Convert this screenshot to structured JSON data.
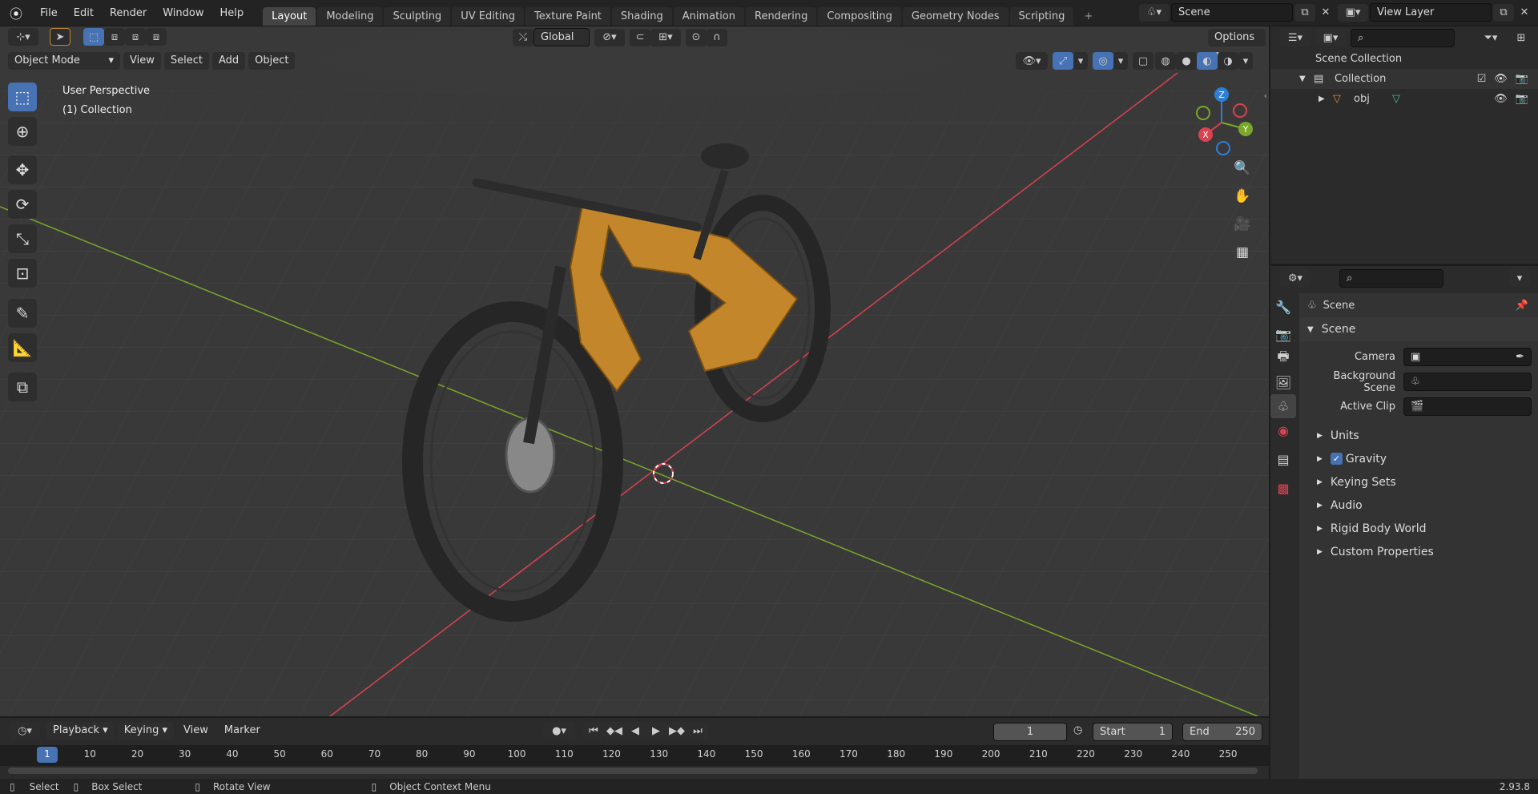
{
  "menu": {
    "items": [
      "File",
      "Edit",
      "Render",
      "Window",
      "Help"
    ]
  },
  "workspaces": {
    "active_index": 0,
    "tabs": [
      "Layout",
      "Modeling",
      "Sculpting",
      "UV Editing",
      "Texture Paint",
      "Shading",
      "Animation",
      "Rendering",
      "Compositing",
      "Geometry Nodes",
      "Scripting"
    ],
    "add_label": "+"
  },
  "scene_selector": {
    "value": "Scene"
  },
  "view_layer": {
    "value": "View Layer"
  },
  "viewport": {
    "transform_orientation": "Global",
    "options_label": "Options",
    "mode": "Object Mode",
    "menus": [
      "View",
      "Select",
      "Add",
      "Object"
    ],
    "perspective_label": "User Perspective",
    "collection_label": "(1) Collection",
    "gizmo_axes": {
      "z": "Z",
      "y": "Y",
      "x": "X"
    },
    "colors": {
      "x_axis": "#d9434f",
      "y_axis": "#7aa82a",
      "z_axis": "#2f7fd6",
      "bike_frame": "#c4862a"
    }
  },
  "outliner": {
    "root": "Scene Collection",
    "collection": "Collection",
    "object": "obj"
  },
  "properties": {
    "header": "Scene",
    "panel_title": "Scene",
    "fields": [
      {
        "label": "Camera",
        "value": ""
      },
      {
        "label": "Background Scene",
        "value": ""
      },
      {
        "label": "Active Clip",
        "value": ""
      }
    ],
    "subpanels": [
      "Units",
      "Gravity",
      "Keying Sets",
      "Audio",
      "Rigid Body World",
      "Custom Properties"
    ],
    "gravity_checked": true
  },
  "timeline": {
    "menus": [
      "Playback",
      "Keying",
      "View",
      "Marker"
    ],
    "current_frame": "1",
    "start_label": "Start",
    "start_value": "1",
    "end_label": "End",
    "end_value": "250",
    "ticks": [
      "1",
      "10",
      "20",
      "30",
      "40",
      "50",
      "60",
      "70",
      "80",
      "90",
      "100",
      "110",
      "120",
      "130",
      "140",
      "150",
      "160",
      "170",
      "180",
      "190",
      "200",
      "210",
      "220",
      "230",
      "240",
      "250"
    ]
  },
  "statusbar": {
    "select": "Select",
    "box_select": "Box Select",
    "rotate_view": "Rotate View",
    "context_menu": "Object Context Menu",
    "version": "2.93.8"
  }
}
